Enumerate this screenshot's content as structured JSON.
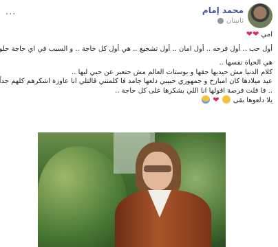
{
  "post": {
    "author": "محمد إمام",
    "timestamp": "ثانيتان",
    "more_menu": "...",
    "lines": {
      "l1": "امي",
      "l2": "أول حب .. أول فرحه .. أول امان .. أول تشجيع .. هي أول كل حاجة .. و السبب في اي حاجة حلوه",
      "l3": "هي الحياة نفسها ..",
      "l4": "كلام الدنيا مش حيديها حقها و بوستات العالم مش حتعبر عن حبي ليها ..",
      "l5": "عيد ميلادها كان امبارح و جمهوري حبيبي دلعها جامد فا كلمتني قالتلي انا عاوزة اشكرهم كلهم جداً",
      "l6": ".. فا قلت فرصة اقولها انا اللي بشكرها على كل حاجة ..",
      "l7": "يلا دلعوها بقى"
    }
  },
  "icons": {
    "avatar": "profile-photo",
    "privacy": "globe-icon",
    "heart": "red-heart-emoji",
    "grin": "grinning-emoji",
    "joy": "tears-of-joy-emoji"
  },
  "colors": {
    "author": "#385898",
    "heart": "#e0245e",
    "meta": "#90949c"
  }
}
